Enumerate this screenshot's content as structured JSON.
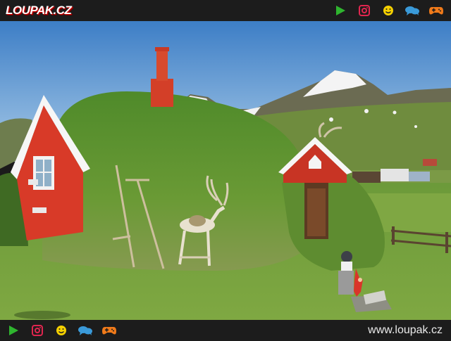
{
  "header": {
    "logo_text": "LOUPAK.CZ",
    "icons": [
      "play-icon",
      "instagram-icon",
      "smiley-icon",
      "chat-icon",
      "gamepad-icon"
    ]
  },
  "footer": {
    "icons": [
      "play-icon",
      "instagram-icon",
      "smiley-icon",
      "chat-icon",
      "gamepad-icon"
    ],
    "site_url": "www.loupak.cz"
  },
  "colors": {
    "bar_bg": "#1c1c1c",
    "play": "#2fb52f",
    "instagram": "#e0264f",
    "smiley": "#f5d000",
    "chat": "#3a9ad9",
    "gamepad": "#f07a1a"
  }
}
